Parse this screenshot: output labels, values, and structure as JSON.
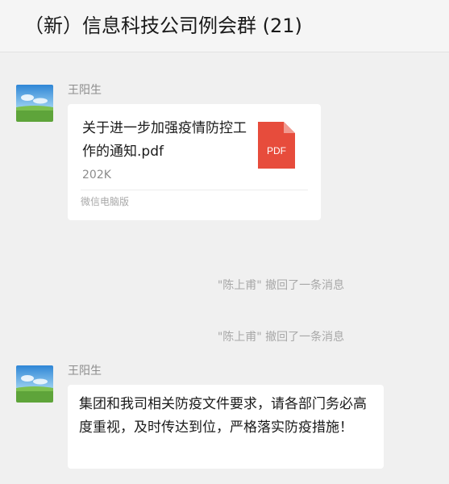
{
  "header": {
    "title": "（新）信息科技公司例会群 (21)"
  },
  "messages": [
    {
      "sender": "王阳生",
      "file": {
        "name": "关于进一步加强疫情防控工作的通知.pdf",
        "size": "202K",
        "source": "微信电脑版",
        "type_label": "PDF",
        "icon_color": "#e74c3c"
      }
    },
    {
      "system": "\"陈上甫\" 撤回了一条消息"
    },
    {
      "system": "\"陈上甫\" 撤回了一条消息"
    },
    {
      "sender": "王阳生",
      "text": "集团和我司相关防疫文件要求，请各部门务必高度重视，及时传达到位，严格落实防疫措施！"
    }
  ],
  "colors": {
    "background": "#f0f0f0",
    "bubble": "#ffffff",
    "secondary_text": "#8c8c8c",
    "pdf_red": "#e74c3c"
  }
}
